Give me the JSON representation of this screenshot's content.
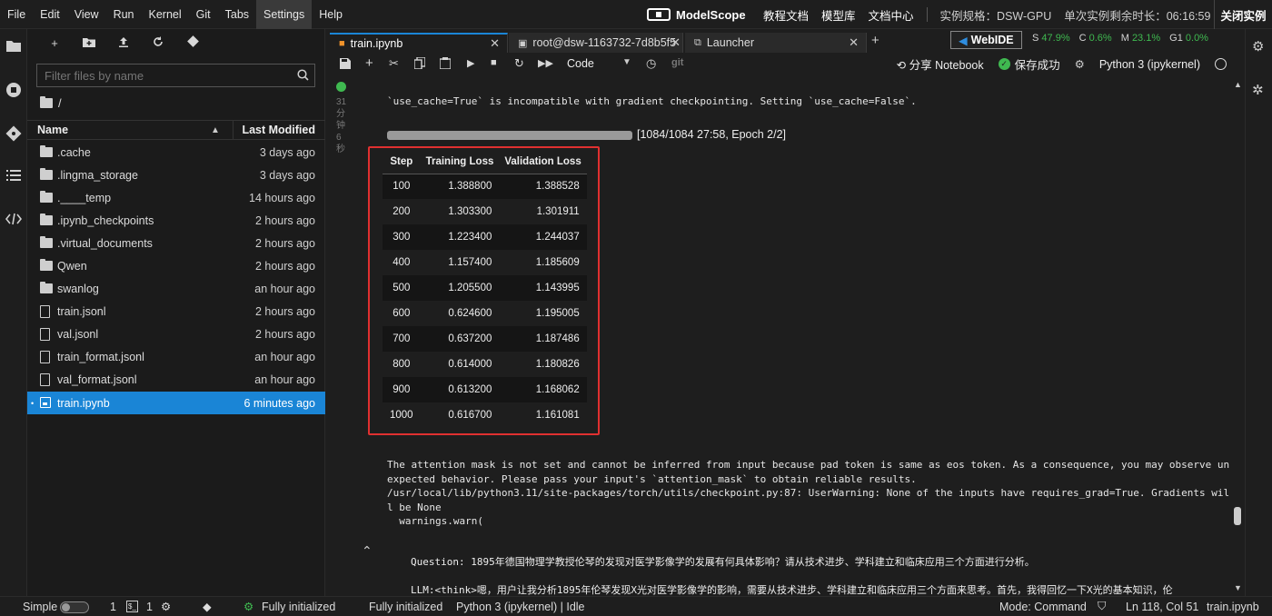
{
  "menubar": {
    "items": [
      "File",
      "Edit",
      "View",
      "Run",
      "Kernel",
      "Git",
      "Tabs",
      "Settings",
      "Help"
    ],
    "active": "Settings",
    "brand": "ModelScope",
    "links": [
      "教程文档",
      "模型库",
      "文档中心"
    ],
    "spec": "实例规格：DSW-GPU",
    "remaining": "单次实例剩余时长：06:16:59",
    "close_instance": "关闭实例"
  },
  "filebrowser": {
    "filter_placeholder": "Filter files by name",
    "path": "/",
    "col_name": "Name",
    "col_modified": "Last Modified",
    "rows": [
      {
        "name": ".cache",
        "modified": "3 days ago",
        "type": "folder"
      },
      {
        "name": ".lingma_storage",
        "modified": "3 days ago",
        "type": "folder"
      },
      {
        "name": ".____temp",
        "modified": "14 hours ago",
        "type": "folder"
      },
      {
        "name": ".ipynb_checkpoints",
        "modified": "2 hours ago",
        "type": "folder"
      },
      {
        "name": ".virtual_documents",
        "modified": "2 hours ago",
        "type": "folder"
      },
      {
        "name": "Qwen",
        "modified": "2 hours ago",
        "type": "folder"
      },
      {
        "name": "swanlog",
        "modified": "an hour ago",
        "type": "folder"
      },
      {
        "name": "train.jsonl",
        "modified": "2 hours ago",
        "type": "file"
      },
      {
        "name": "val.jsonl",
        "modified": "2 hours ago",
        "type": "file"
      },
      {
        "name": "train_format.jsonl",
        "modified": "an hour ago",
        "type": "file"
      },
      {
        "name": "val_format.jsonl",
        "modified": "an hour ago",
        "type": "file"
      },
      {
        "name": "train.ipynb",
        "modified": "6 minutes ago",
        "type": "notebook",
        "selected": true
      }
    ]
  },
  "tabs": [
    {
      "label": "train.ipynb",
      "active": true
    },
    {
      "label": "root@dsw-1163732-7d8b5f5",
      "active": false
    },
    {
      "label": "Launcher",
      "active": false
    }
  ],
  "notebook_toolbar": {
    "cell_type": "Code",
    "git": "git",
    "webide": "WebIDE",
    "metrics": {
      "s": "S",
      "s_val": "47.9%",
      "c": "C",
      "c_val": "0.6%",
      "m": "M",
      "m_val": "23.1%",
      "g": "G1",
      "g_val": "0.0%"
    },
    "share": "分享 Notebook",
    "saved": "保存成功",
    "kernel": "Python 3 (ipykernel)"
  },
  "cell": {
    "time_label": [
      "31",
      "分",
      "钟6",
      "秒"
    ],
    "warning_line": "`use_cache=True` is incompatible with gradient checkpointing. Setting `use_cache=False`.",
    "progress_fraction": 1.0,
    "progress_label": "[1084/1084 27:58, Epoch 2/2]",
    "table_headers": [
      "Step",
      "Training Loss",
      "Validation Loss"
    ],
    "table_rows": [
      [
        "100",
        "1.388800",
        "1.388528"
      ],
      [
        "200",
        "1.303300",
        "1.301911"
      ],
      [
        "300",
        "1.223400",
        "1.244037"
      ],
      [
        "400",
        "1.157400",
        "1.185609"
      ],
      [
        "500",
        "1.205500",
        "1.143995"
      ],
      [
        "600",
        "0.624600",
        "1.195005"
      ],
      [
        "700",
        "0.637200",
        "1.187486"
      ],
      [
        "800",
        "0.614000",
        "1.180826"
      ],
      [
        "900",
        "0.613200",
        "1.168062"
      ],
      [
        "1000",
        "0.616700",
        "1.161081"
      ]
    ],
    "stderr_lines": [
      "The attention mask is not set and cannot be inferred from input because pad token is same as eos token. As a consequence, you may observe un",
      "expected behavior. Please pass your input's `attention_mask` to obtain reliable results.",
      "/usr/local/lib/python3.11/site-packages/torch/utils/checkpoint.py:87: UserWarning: None of the inputs have requires_grad=True. Gradients wil",
      "l be None",
      "  warnings.warn("
    ],
    "question": "Question: 1895年德国物理学教授伦琴的发现对医学影像学的发展有何具体影响？请从技术进步、学科建立和临床应用三个方面进行分析。",
    "llm": "LLM:<think>嗯，用户让我分析1895年伦琴发现X光对医学影像学的影响，需要从技术进步、学科建立和临床应用三个方面来思考。首先，我得回忆一下X光的基本知识，伦"
  },
  "statusbar": {
    "mode_label": "Simple",
    "terminals": "1",
    "kernels": "1",
    "git_status": "Fully initialized",
    "lsp_status": "Fully initialized",
    "kernel_status": "Python 3 (ipykernel) | Idle",
    "mode": "Mode: Command",
    "position": "Ln 118, Col 51",
    "filename": "train.ipynb"
  }
}
